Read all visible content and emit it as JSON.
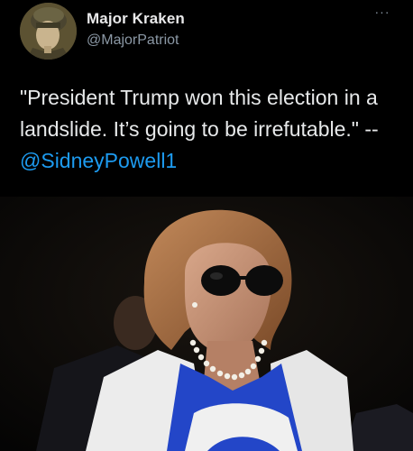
{
  "author": {
    "display_name": "Major Kraken",
    "handle": "@MajorPatriot",
    "avatar_icon": "avatar-photo-icon"
  },
  "menu": {
    "more_label": "···",
    "more_icon": "more-options-icon"
  },
  "tweet": {
    "text": "\"President Trump won this election in a landslide. It’s going to be irrefutable.\" -- ",
    "mention": "@SidneyPowell1"
  },
  "media": {
    "description_icon": "photo-woman-sunglasses-icon"
  },
  "colors": {
    "background": "#000000",
    "text": "#e7e9ea",
    "secondary": "#8b98a5",
    "link": "#1d9bf0"
  }
}
